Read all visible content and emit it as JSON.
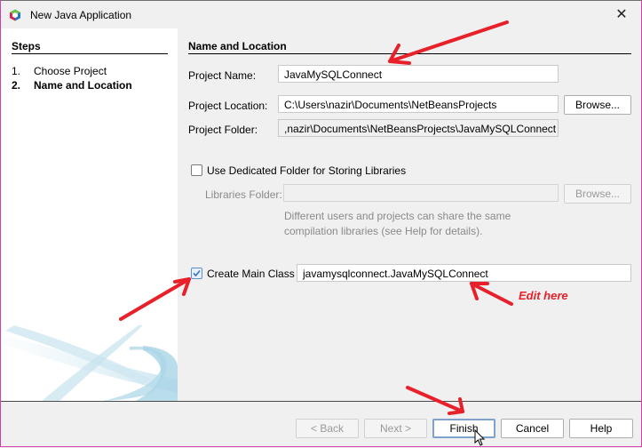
{
  "window": {
    "title": "New Java Application",
    "close_icon": "close-icon"
  },
  "steps": {
    "title": "Steps",
    "items": [
      {
        "num": "1.",
        "label": "Choose Project",
        "current": false
      },
      {
        "num": "2.",
        "label": "Name and Location",
        "current": true
      }
    ]
  },
  "form": {
    "section_title": "Name and Location",
    "project_name_label": "Project Name:",
    "project_name_value": "JavaMySQLConnect",
    "project_location_label": "Project Location:",
    "project_location_value": "C:\\Users\\nazir\\Documents\\NetBeansProjects",
    "browse_label": "Browse...",
    "project_folder_label": "Project Folder:",
    "project_folder_value": ",nazir\\Documents\\NetBeansProjects\\JavaMySQLConnect",
    "dedicated_folder_label": "Use Dedicated Folder for Storing Libraries",
    "dedicated_folder_checked": false,
    "libraries_folder_label": "Libraries Folder:",
    "libraries_folder_value": "",
    "libraries_browse_label": "Browse...",
    "help_line1": "Different users and projects can share the same",
    "help_line2": "compilation libraries (see Help for details).",
    "create_main_class_label": "Create Main Class",
    "create_main_class_checked": true,
    "main_class_value": "javamysqlconnect.JavaMySQLConnect"
  },
  "annotation": {
    "edit_here": "Edit here",
    "color": "#e8202a"
  },
  "buttons": {
    "back": "< Back",
    "next": "Next >",
    "finish": "Finish",
    "cancel": "Cancel",
    "help": "Help"
  }
}
